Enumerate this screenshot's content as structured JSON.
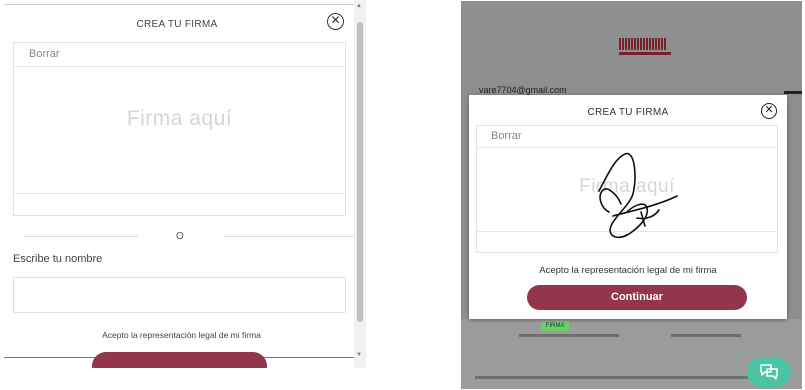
{
  "left": {
    "title": "CREA TU FIRMA",
    "close_glyph": "✕",
    "clear_label": "Borrar",
    "signature_placeholder": "Firma aquí",
    "separator": "O",
    "name_label": "Escribe tu nombre",
    "name_value": "",
    "accept_text": "Acepto la representación legal de mi firma"
  },
  "right": {
    "email": "vare7704@gmail.com",
    "badge": "FIRMA",
    "modal": {
      "title": "CREA TU FIRMA",
      "close_glyph": "✕",
      "clear_label": "Borrar",
      "signature_placeholder": "Firma aquí",
      "accept_text": "Acepto la representación legal de mi firma",
      "continue_label": "Continuar"
    }
  },
  "colors": {
    "brand": "#93364a",
    "chat": "#4cc4a4",
    "badge": "#6bd067"
  },
  "icons": {
    "close": "close-circle-icon",
    "chat": "chat-bubbles-icon",
    "logo": "building-logo"
  }
}
